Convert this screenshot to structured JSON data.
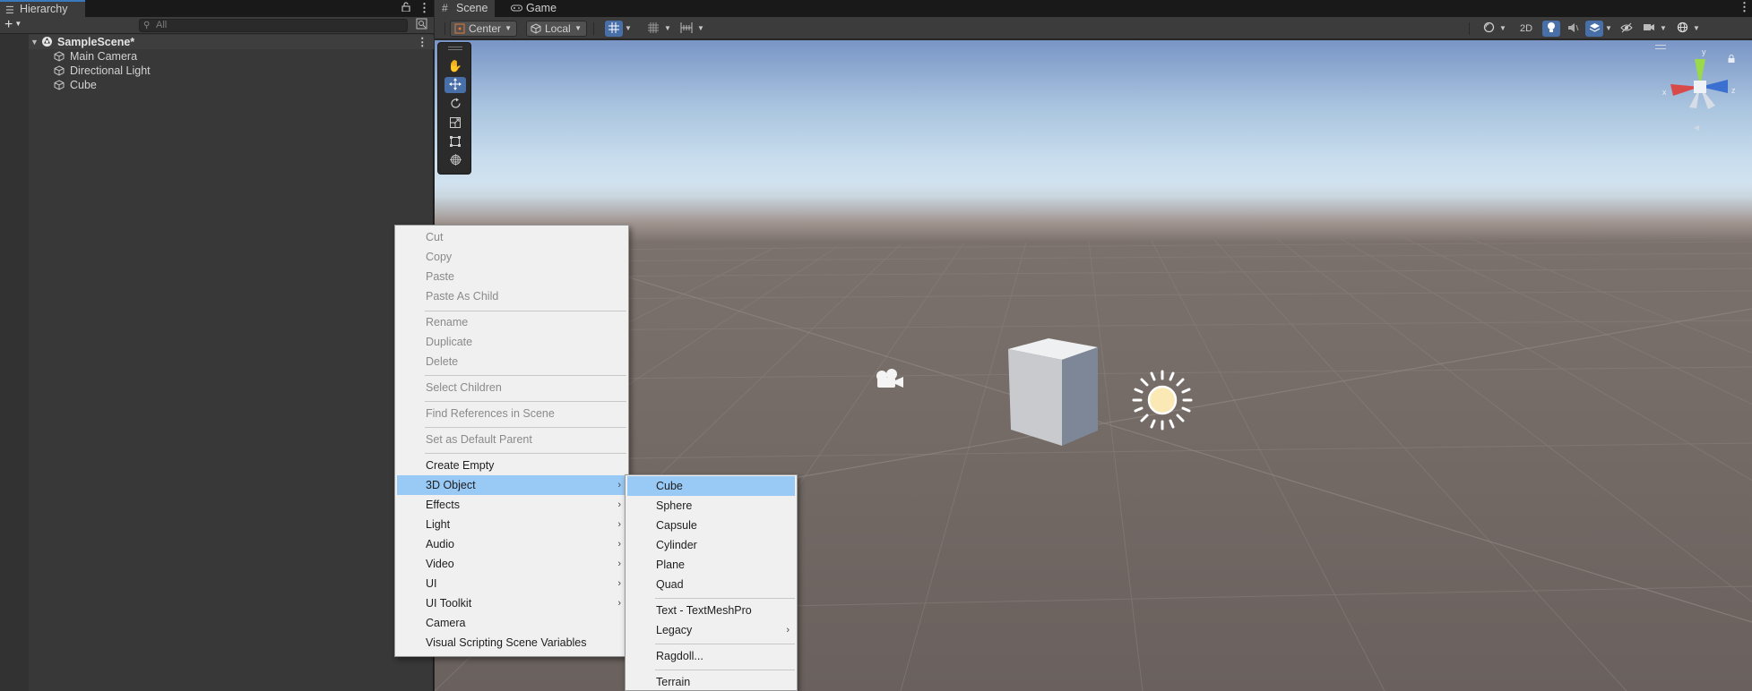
{
  "hierarchy": {
    "tab_label": "Hierarchy",
    "search_placeholder": "All",
    "scene_name": "SampleScene*",
    "objects": [
      {
        "label": "Main Camera"
      },
      {
        "label": "Directional Light"
      },
      {
        "label": "Cube"
      }
    ]
  },
  "scene_view": {
    "tabs": [
      {
        "label": "Scene"
      },
      {
        "label": "Game"
      }
    ],
    "pivot_mode": "Center",
    "pivot_rotation": "Local",
    "mode_2d_label": "2D"
  },
  "context_menu": {
    "items": [
      {
        "label": "Cut",
        "enabled": false
      },
      {
        "label": "Copy",
        "enabled": false
      },
      {
        "label": "Paste",
        "enabled": false
      },
      {
        "label": "Paste As Child",
        "enabled": false
      },
      {
        "label": "Rename",
        "enabled": false
      },
      {
        "label": "Duplicate",
        "enabled": false
      },
      {
        "label": "Delete",
        "enabled": false
      },
      {
        "label": "Select Children",
        "enabled": false
      },
      {
        "label": "Find References in Scene",
        "enabled": false
      },
      {
        "label": "Set as Default Parent",
        "enabled": false
      },
      {
        "label": "Create Empty",
        "enabled": true
      },
      {
        "label": "3D Object",
        "enabled": true,
        "submenu": true,
        "selected": true
      },
      {
        "label": "Effects",
        "enabled": true,
        "submenu": true
      },
      {
        "label": "Light",
        "enabled": true,
        "submenu": true
      },
      {
        "label": "Audio",
        "enabled": true,
        "submenu": true
      },
      {
        "label": "Video",
        "enabled": true,
        "submenu": true
      },
      {
        "label": "UI",
        "enabled": true,
        "submenu": true
      },
      {
        "label": "UI Toolkit",
        "enabled": true,
        "submenu": true
      },
      {
        "label": "Camera",
        "enabled": true
      },
      {
        "label": "Visual Scripting Scene Variables",
        "enabled": true
      }
    ]
  },
  "submenu_3d_object": {
    "items": [
      {
        "label": "Cube",
        "selected": true
      },
      {
        "label": "Sphere"
      },
      {
        "label": "Capsule"
      },
      {
        "label": "Cylinder"
      },
      {
        "label": "Plane"
      },
      {
        "label": "Quad"
      },
      {
        "label": "Text - TextMeshPro"
      },
      {
        "label": "Legacy",
        "submenu": true
      },
      {
        "label": "Ragdoll..."
      },
      {
        "label": "Terrain"
      }
    ]
  },
  "gizmo": {
    "axis_y": "y",
    "axis_x": "x",
    "axis_z": "z"
  },
  "colors": {
    "selection_blue": "#99c9f5",
    "tab_accent": "#3a79bb",
    "active_tool": "#486fa8"
  }
}
